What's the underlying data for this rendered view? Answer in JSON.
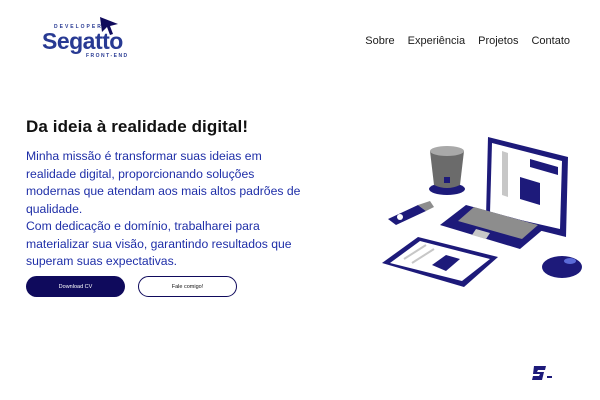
{
  "logo": {
    "top_word": "DEVELOPER",
    "main_word": "Segatto",
    "sub_word": "FRONT-END"
  },
  "nav": {
    "items": [
      "Sobre",
      "Experiência",
      "Projetos",
      "Contato"
    ]
  },
  "hero": {
    "title": "Da ideia à realidade digital!",
    "paragraph1": "Minha missão é transformar suas ideias em realidade digital, proporcionando soluções modernas que atendam aos mais altos padrões de qualidade.",
    "paragraph2": "Com dedicação e domínio, trabalharei para materializar sua visão, garantindo resultados que superam suas expectativas.",
    "primary_button": "Download CV",
    "secondary_button": "Fale comigo!"
  },
  "colors": {
    "brand": "#283a93",
    "text_accent": "#1f2fa8",
    "button_dark": "#0f0a5c"
  },
  "icons": {
    "logo_cursor": "cursor-arrow-icon",
    "illustration": "laptop-workspace-illustration",
    "badge": "s-logo-icon"
  }
}
